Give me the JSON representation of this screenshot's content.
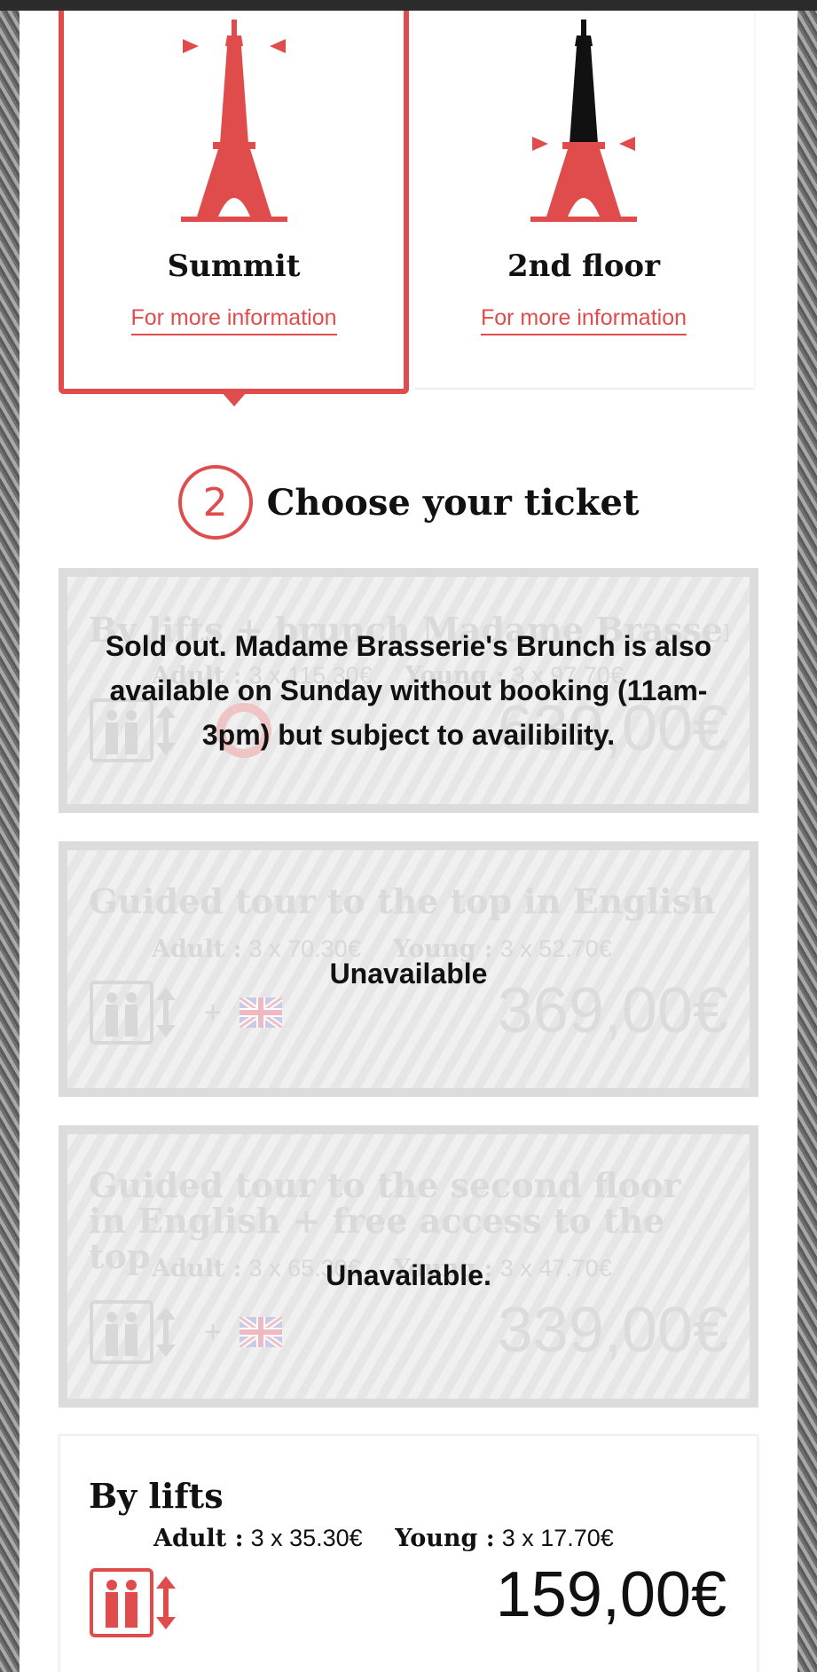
{
  "floors": [
    {
      "name": "Summit",
      "link": "For more information",
      "selected": true
    },
    {
      "name": "2nd floor",
      "link": "For more information",
      "selected": false
    }
  ],
  "step": {
    "number": "2",
    "title": "Choose your ticket"
  },
  "tickets": [
    {
      "title": "By lifts + brunch Madame Brasserie",
      "adult_label": "Adult :",
      "adult_value": "3 x 115.30€",
      "young_label": "Young :",
      "young_value": "3 x 97.70€",
      "total": "639,00€",
      "overlay": "Sold out. Madame Brasserie's Brunch is also available on Sunday without booking (11am-3pm) but subject to availibility."
    },
    {
      "title": "Guided tour to the top in English",
      "adult_label": "Adult :",
      "adult_value": "3 x 70.30€",
      "young_label": "Young :",
      "young_value": "3 x 52.70€",
      "total": "369,00€",
      "overlay": "Unavailable"
    },
    {
      "title": "Guided tour to the second floor in English + free access to the top",
      "adult_label": "Adult :",
      "adult_value": "3 x 65.30€",
      "young_label": "Young :",
      "young_value": "3 x 47.70€",
      "total": "339,00€",
      "overlay": "Unavailable."
    },
    {
      "title": "By lifts",
      "adult_label": "Adult :",
      "adult_value": "3 x 35.30€",
      "young_label": "Young :",
      "young_value": "3 x 17.70€",
      "total": "159,00€"
    }
  ],
  "icons": {
    "tower": "eiffel-tower-icon",
    "lift": "lift-icon",
    "arrows": "up-down-arrows-icon",
    "flag": "uk-flag-icon",
    "brunch": "brunch-icon"
  },
  "colors": {
    "accent": "#e04c4c",
    "dark": "#111111",
    "disabled_text": "#dadada"
  }
}
